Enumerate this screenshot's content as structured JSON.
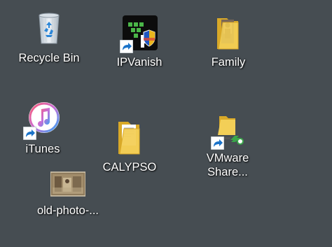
{
  "desktop": {
    "icons": [
      {
        "label": "Recycle Bin",
        "icon": "recycle-bin-icon"
      },
      {
        "label": "IPVanish",
        "icon": "ipvanish-icon"
      },
      {
        "label": "Family",
        "icon": "folder-icon"
      },
      {
        "label": "iTunes",
        "icon": "itunes-icon"
      },
      {
        "label": "CALYPSO",
        "icon": "folder-icon"
      },
      {
        "label": "VMware\nShare...",
        "icon": "vmware-shared-folder-icon"
      },
      {
        "label": "old-photo-...",
        "icon": "image-thumbnail-icon"
      }
    ]
  },
  "colors": {
    "desktop_background": "#464d52",
    "folder_yellow": "#f1c84b",
    "shortcut_arrow_blue": "#1a73c9"
  }
}
